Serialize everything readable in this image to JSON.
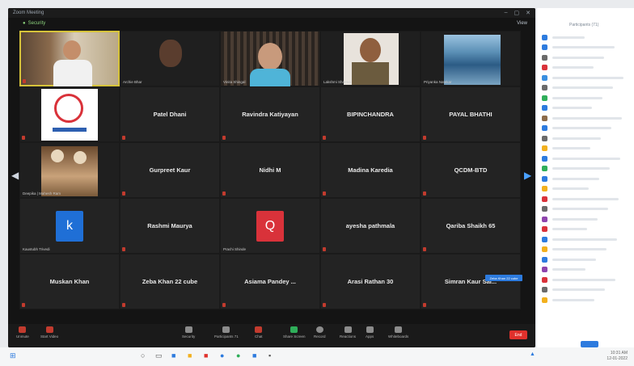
{
  "window": {
    "title": "Zoom Meeting"
  },
  "subbar": {
    "security": "Security",
    "view": "View"
  },
  "tiles": [
    {
      "name": "",
      "caption": "",
      "type": "video-man"
    },
    {
      "name": "",
      "caption": "Archie Bhar",
      "type": "video-woman"
    },
    {
      "name": "",
      "caption": "Vinita Shingal",
      "type": "video-girl"
    },
    {
      "name": "",
      "caption": "Lakshmi Sharma",
      "type": "video-man2"
    },
    {
      "name": "",
      "caption": "Priyanka Natekar",
      "type": "video-landscape"
    },
    {
      "name": "",
      "caption": "",
      "type": "logo"
    },
    {
      "name": "Patel Dhani",
      "caption": "",
      "type": "name"
    },
    {
      "name": "Ravindra Katiyayan",
      "caption": "",
      "type": "name"
    },
    {
      "name": "BIPINCHANDRA",
      "caption": "",
      "type": "name"
    },
    {
      "name": "PAYAL BHATHI",
      "caption": "",
      "type": "name"
    },
    {
      "name": "",
      "caption": "Deepika | Mahesh Ram",
      "type": "video-figures"
    },
    {
      "name": "Gurpreet Kaur",
      "caption": "",
      "type": "name"
    },
    {
      "name": "Nidhi M",
      "caption": "",
      "type": "name"
    },
    {
      "name": "Madina Karedia",
      "caption": "",
      "type": "name"
    },
    {
      "name": "QCDM-BTD",
      "caption": "",
      "type": "name"
    },
    {
      "name": "",
      "caption": "Kaustubh Trivedi",
      "type": "avatar-k",
      "letter": "k"
    },
    {
      "name": "Rashmi Maurya",
      "caption": "",
      "type": "name"
    },
    {
      "name": "",
      "caption": "Prachi Shinde",
      "type": "avatar-q",
      "letter": "Q"
    },
    {
      "name": "ayesha pathmala",
      "caption": "",
      "type": "name"
    },
    {
      "name": "Qariba Shaikh 65",
      "caption": "",
      "type": "name"
    },
    {
      "name": "Muskan Khan",
      "caption": "",
      "type": "name"
    },
    {
      "name": "Zeba Khan 22 cube",
      "caption": "",
      "type": "name"
    },
    {
      "name": "Asiama Pandey ...",
      "caption": "",
      "type": "name"
    },
    {
      "name": "Arasi Rathan 30",
      "caption": "",
      "type": "name"
    },
    {
      "name": "Simran Kaur Sai...",
      "caption": "",
      "type": "name"
    }
  ],
  "speaking_badge": "Zeba Khan 22 cube",
  "toolbar": {
    "unmute": "Unmute",
    "start_video": "Start Video",
    "security": "Security",
    "participants": "Participants",
    "participant_count": "71",
    "chat": "Chat",
    "share": "Share Screen",
    "record": "Record",
    "reactions": "Reactions",
    "apps": "Apps",
    "whiteboards": "Whiteboards",
    "end": "End"
  },
  "panel": {
    "title": "Participants (71)",
    "participants": [
      "",
      "",
      "",
      "",
      "",
      "",
      "",
      "",
      "",
      "",
      "",
      "",
      "",
      "",
      "",
      "",
      "",
      "",
      "",
      "",
      "",
      "",
      "",
      "",
      "",
      "",
      ""
    ]
  },
  "taskbar": {
    "time": "10:31 AM",
    "date": "12-01-2022"
  },
  "colors": {
    "accent": "#2d7bde",
    "end": "#e0312c",
    "speaker_border": "#d6c33a",
    "avatar_k": "#1f6fd6",
    "avatar_q": "#d9323a"
  }
}
